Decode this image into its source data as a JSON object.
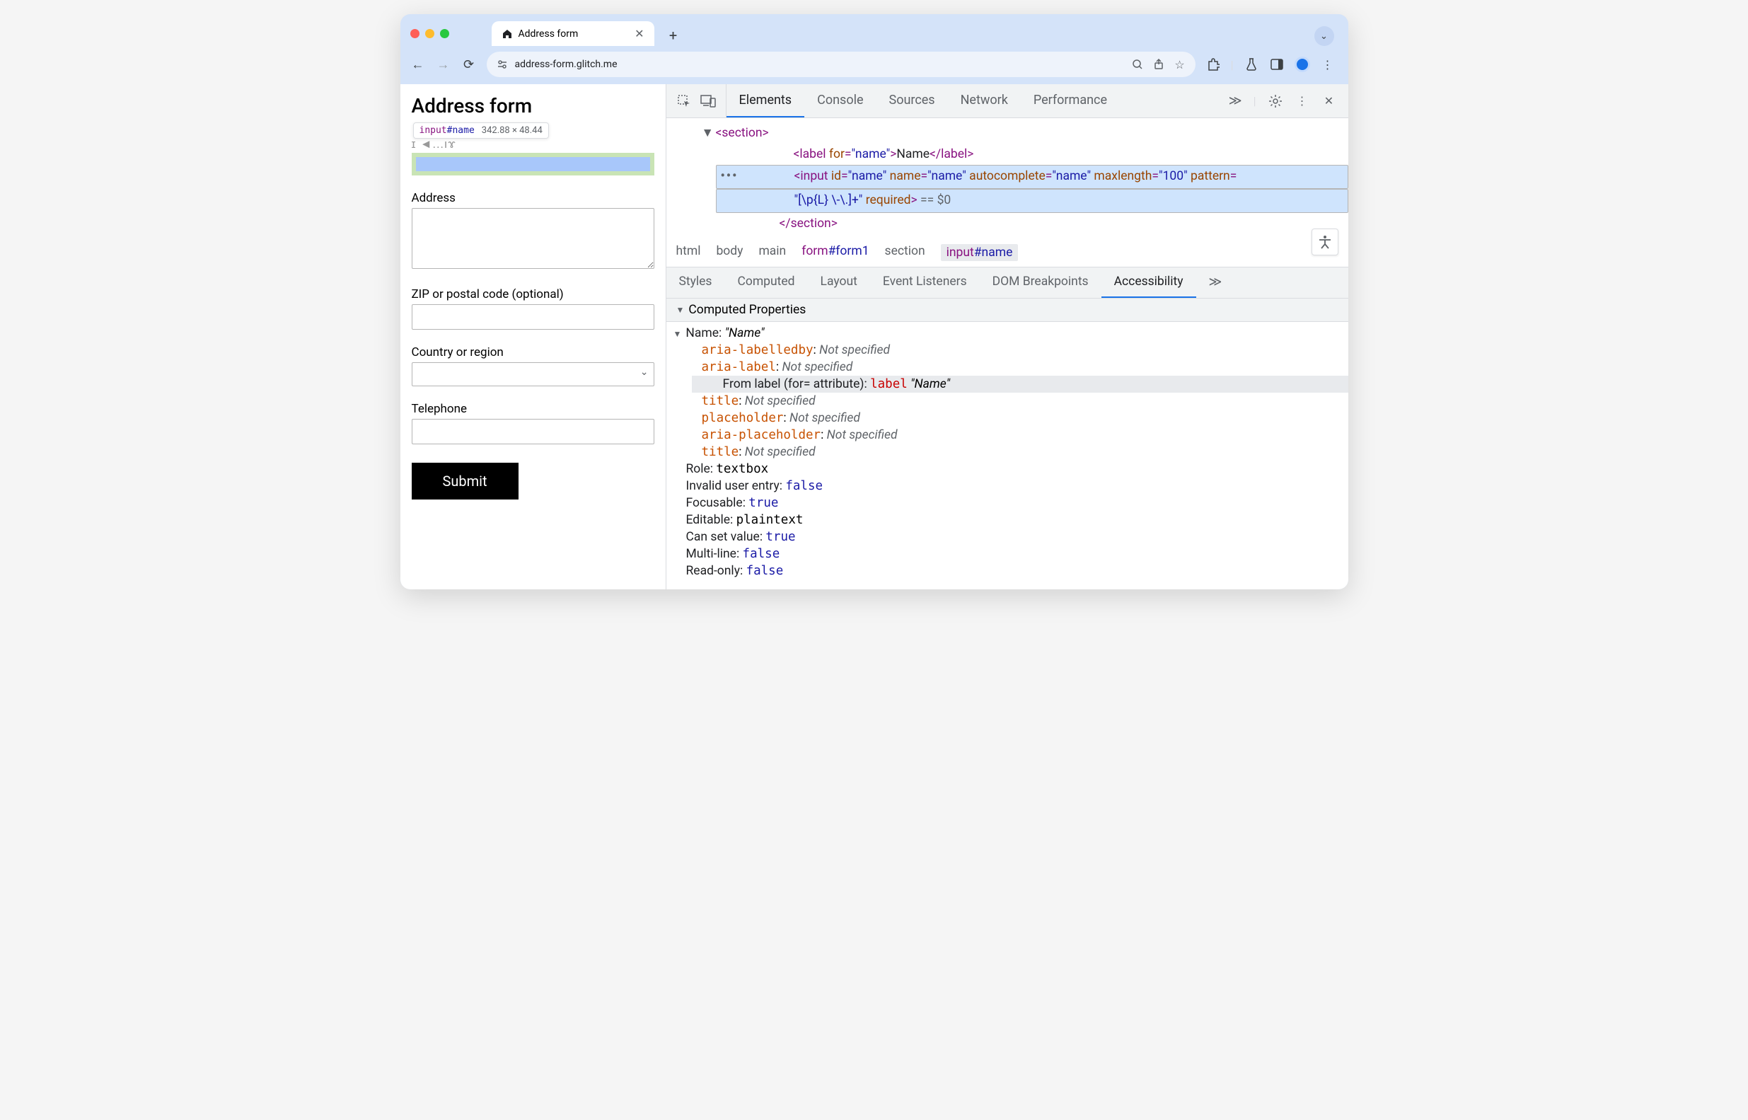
{
  "browser": {
    "tab_title": "Address form",
    "url": "address-form.glitch.me"
  },
  "page": {
    "heading": "Address form",
    "tooltip_tag": "input",
    "tooltip_id": "#name",
    "tooltip_dims": "342.88 × 48.44",
    "hidden_label": "ɪ ◄...ıɤ",
    "labels": {
      "address": "Address",
      "zip": "ZIP or postal code (optional)",
      "country": "Country or region",
      "telephone": "Telephone"
    },
    "submit": "Submit"
  },
  "devtools": {
    "tabs": [
      "Elements",
      "Console",
      "Sources",
      "Network",
      "Performance"
    ],
    "active_tab": "Elements",
    "dom": {
      "section_open": "<section>",
      "label_open": "<label",
      "label_for_attr": "for",
      "label_for_val": "\"name\"",
      "label_close": ">",
      "label_text": "Name",
      "label_end": "</label>",
      "input_open": "<input",
      "attrs": {
        "id": {
          "k": "id",
          "v": "\"name\""
        },
        "name": {
          "k": "name",
          "v": "\"name\""
        },
        "autocomplete": {
          "k": "autocomplete",
          "v": "\"name\""
        },
        "maxlength": {
          "k": "maxlength",
          "v": "\"100\""
        },
        "pattern": {
          "k": "pattern",
          "v": "="
        }
      },
      "pattern_val": "\"[\\p{L} \\-\\.]+\"",
      "required": "required",
      "input_close": ">",
      "eq_dollar": " == $0",
      "section_close": "</section>"
    },
    "breadcrumbs": [
      "html",
      "body",
      "main",
      "form#form1",
      "section",
      "input#name"
    ],
    "subtabs": [
      "Styles",
      "Computed",
      "Layout",
      "Event Listeners",
      "DOM Breakpoints",
      "Accessibility"
    ],
    "active_subtab": "Accessibility",
    "a11y": {
      "panel_title": "Computed Properties",
      "name_label": "Name: ",
      "name_value": "\"Name\"",
      "sources": [
        {
          "prop": "aria-labelledby",
          "val": "Not specified",
          "type": "ns"
        },
        {
          "prop": "aria-label",
          "val": "Not specified",
          "type": "ns"
        },
        {
          "from_label": "From label (for= attribute): ",
          "element": "label",
          "quoted": "\"Name\"",
          "highlight": true
        },
        {
          "prop": "title",
          "val": "Not specified",
          "type": "ns"
        },
        {
          "prop": "placeholder",
          "val": "Not specified",
          "type": "ns"
        },
        {
          "prop": "aria-placeholder",
          "val": "Not specified",
          "type": "ns"
        },
        {
          "prop": "title",
          "val": "Not specified",
          "type": "ns"
        }
      ],
      "props": [
        {
          "k": "Role: ",
          "v": "textbox",
          "cls": "mono"
        },
        {
          "k": "Invalid user entry: ",
          "v": "false",
          "cls": "kw"
        },
        {
          "k": "Focusable: ",
          "v": "true",
          "cls": "kw"
        },
        {
          "k": "Editable: ",
          "v": "plaintext",
          "cls": "mono"
        },
        {
          "k": "Can set value: ",
          "v": "true",
          "cls": "kw"
        },
        {
          "k": "Multi-line: ",
          "v": "false",
          "cls": "kw"
        },
        {
          "k": "Read-only: ",
          "v": "false",
          "cls": "kw"
        }
      ]
    }
  }
}
